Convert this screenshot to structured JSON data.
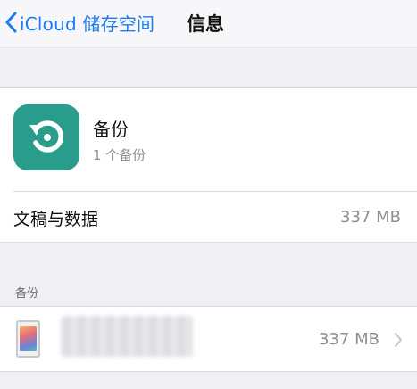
{
  "navbar": {
    "back_label": "iCloud 储存空间",
    "title": "信息"
  },
  "summary": {
    "app_icon": "backup-restore-icon",
    "app_title": "备份",
    "app_subtitle": "1 个备份",
    "docs_label": "文稿与数据",
    "docs_value": "337 MB"
  },
  "backups_section": {
    "header": "备份",
    "items": [
      {
        "device_icon": "ipad-icon",
        "name": "",
        "size": "337 MB"
      }
    ]
  },
  "colors": {
    "accent": "#1a7cf5",
    "icon_background": "#2a9c8b",
    "background": "#efeff4"
  }
}
